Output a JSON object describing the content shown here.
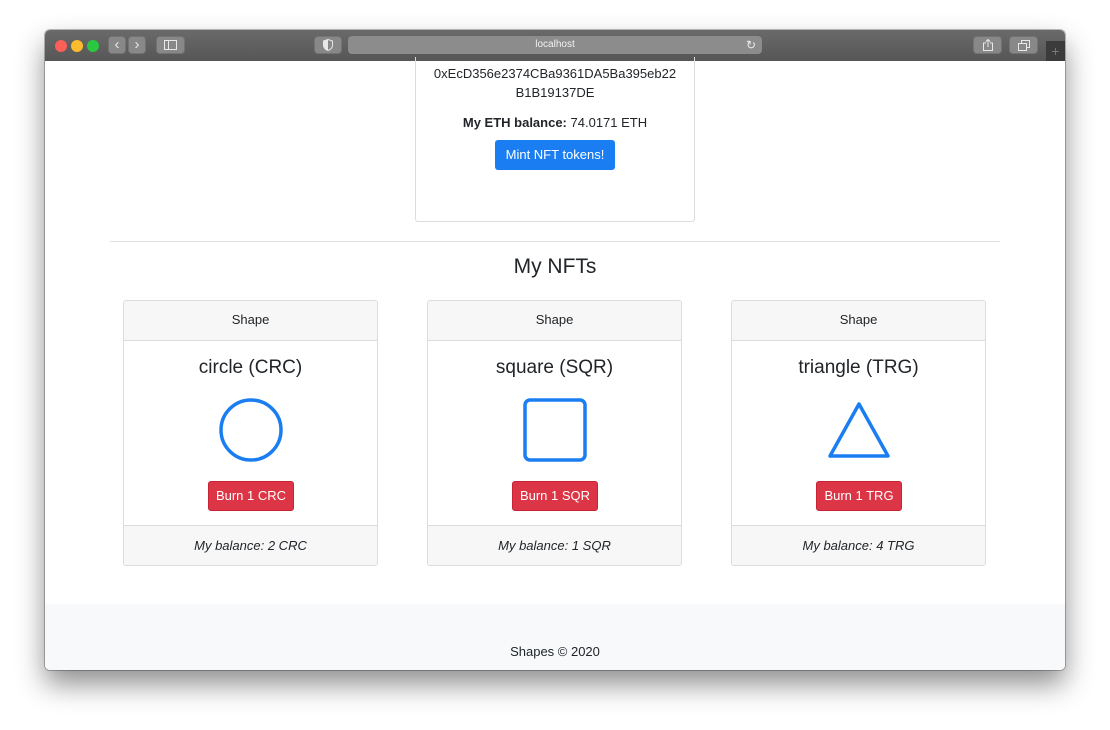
{
  "browser": {
    "url": "localhost",
    "controls": {
      "back_glyph": "‹",
      "forward_glyph": "›",
      "reload_glyph": "↻",
      "new_tab_glyph": "+"
    }
  },
  "wallet": {
    "address_line1": "0xEcD356e2374CBa9361DA5Ba395eb22",
    "address_line2": "B1B19137DE",
    "balance_label": "My ETH balance:",
    "balance_value": "74.0171 ETH",
    "mint_label": "Mint NFT tokens!"
  },
  "nfts": {
    "title": "My NFTs",
    "cards": [
      {
        "header": "Shape",
        "title": "circle (CRC)",
        "shape": "circle",
        "burn_label": "Burn 1 CRC",
        "balance": "My balance: 2 CRC"
      },
      {
        "header": "Shape",
        "title": "square (SQR)",
        "shape": "square",
        "burn_label": "Burn 1 SQR",
        "balance": "My balance: 1 SQR"
      },
      {
        "header": "Shape",
        "title": "triangle (TRG)",
        "shape": "triangle",
        "burn_label": "Burn 1 TRG",
        "balance": "My balance: 4 TRG"
      }
    ]
  },
  "footer": {
    "text": "Shapes © 2020"
  },
  "colors": {
    "primary": "#1a7ef2",
    "danger": "#dc3545",
    "shape_stroke": "#1a7ef2"
  }
}
